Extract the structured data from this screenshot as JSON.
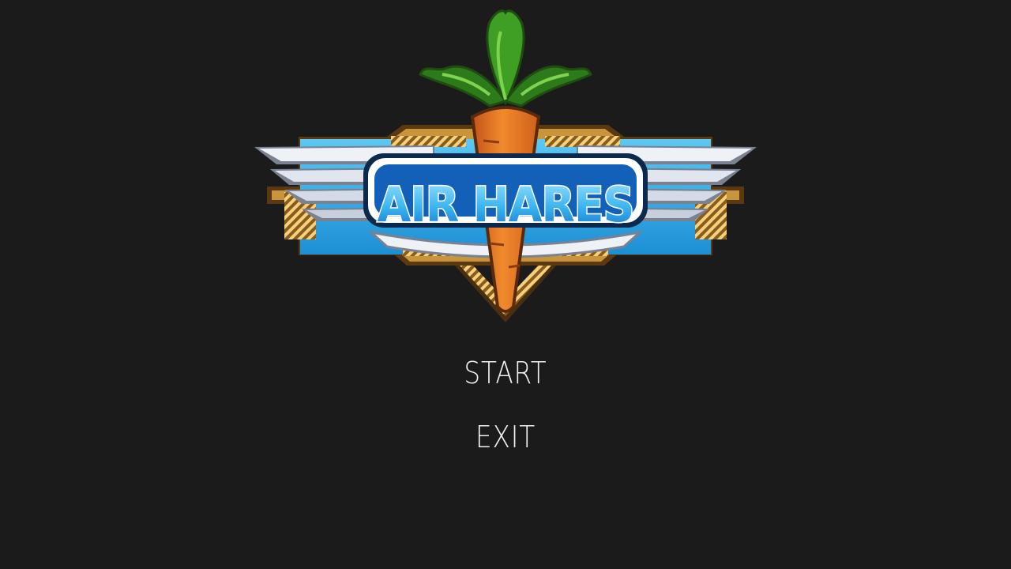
{
  "game": {
    "logo_text": "AIR HARES",
    "colors": {
      "background": "#1b1b1b",
      "menu_text": "#f2f2f2",
      "sky_blue": "#36b3ea",
      "gold": "#c8953c",
      "carrot": "#e9731f",
      "leaf": "#3f9f25",
      "wing": "#eef1f5"
    }
  },
  "menu": {
    "items": [
      {
        "label": "START"
      },
      {
        "label": "EXIT"
      }
    ]
  }
}
